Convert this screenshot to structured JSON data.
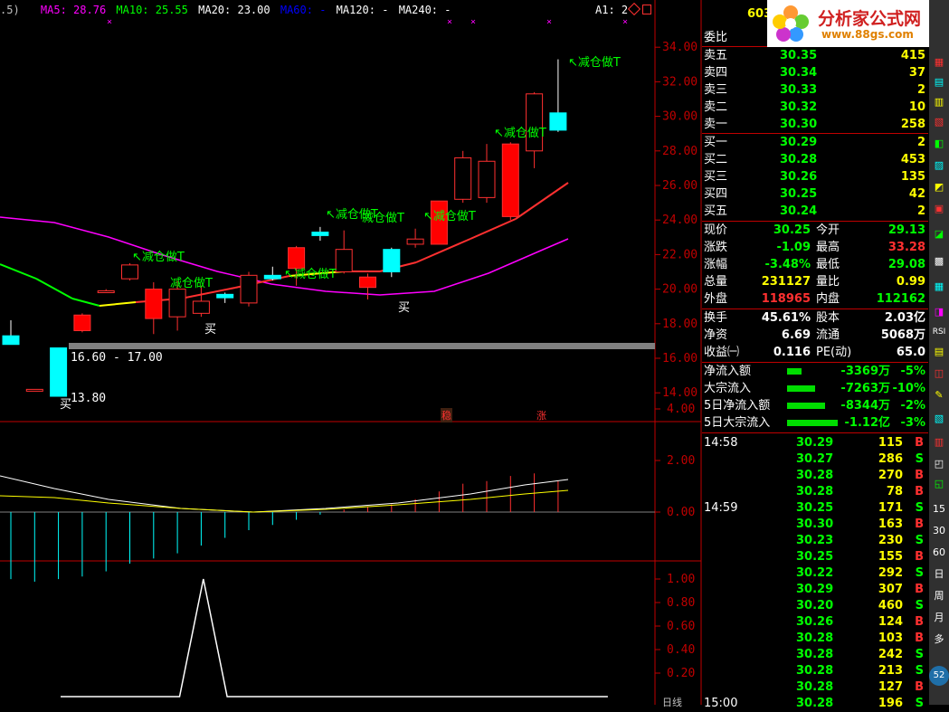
{
  "ma_header": {
    "prefix": ".5)",
    "ma5": "MA5: 28.76",
    "ma10": "MA10: 25.55",
    "ma20": "MA20: 23.00",
    "ma60": "MA60: -",
    "ma120": "MA120: -",
    "ma240": "MA240: -",
    "a1": "A1: 2",
    "code": "603"
  },
  "logo": {
    "text": "分析家公式网",
    "url": "www.88gs.com"
  },
  "price_axis": [
    "34.00",
    "32.00",
    "30.00",
    "28.00",
    "26.00",
    "24.00",
    "22.00",
    "20.00",
    "18.00",
    "16.00",
    "14.00"
  ],
  "macd_axis": [
    "4.00",
    "2.00",
    "0.00"
  ],
  "ind_axis": [
    "1.00",
    "0.80",
    "0.60",
    "0.40",
    "0.20"
  ],
  "annotations": {
    "range_label": "16.60 - 17.00",
    "low_label": "13.80",
    "buy": "买",
    "reduce": "减仓做T",
    "arrow": "↖",
    "wen": "稳",
    "zhang": "涨"
  },
  "order_book": {
    "weibi_label": "委比",
    "sells": [
      {
        "label": "卖五",
        "price": "30.35",
        "vol": "415"
      },
      {
        "label": "卖四",
        "price": "30.34",
        "vol": "37"
      },
      {
        "label": "卖三",
        "price": "30.33",
        "vol": "2"
      },
      {
        "label": "卖二",
        "price": "30.32",
        "vol": "10"
      },
      {
        "label": "卖一",
        "price": "30.30",
        "vol": "258"
      }
    ],
    "buys": [
      {
        "label": "买一",
        "price": "30.29",
        "vol": "2"
      },
      {
        "label": "买二",
        "price": "30.28",
        "vol": "453"
      },
      {
        "label": "买三",
        "price": "30.26",
        "vol": "135"
      },
      {
        "label": "买四",
        "price": "30.25",
        "vol": "42"
      },
      {
        "label": "买五",
        "price": "30.24",
        "vol": "2"
      }
    ]
  },
  "quote": [
    {
      "l1": "现价",
      "v1": "30.25",
      "l2": "今开",
      "v2": "29.13",
      "c1": "#00ff00",
      "c2": "#00ff00"
    },
    {
      "l1": "涨跌",
      "v1": "-1.09",
      "l2": "最高",
      "v2": "33.28",
      "c1": "#00ff00",
      "c2": "#ff3030"
    },
    {
      "l1": "涨幅",
      "v1": "-3.48%",
      "l2": "最低",
      "v2": "29.08",
      "c1": "#00ff00",
      "c2": "#00ff00"
    },
    {
      "l1": "总量",
      "v1": "231127",
      "l2": "量比",
      "v2": "0.99",
      "c1": "#ffff00",
      "c2": "#ffff00"
    },
    {
      "l1": "外盘",
      "v1": "118965",
      "l2": "内盘",
      "v2": "112162",
      "c1": "#ff3030",
      "c2": "#00ff00"
    },
    {
      "l1": "换手",
      "v1": "45.61%",
      "l2": "股本",
      "v2": "2.03亿",
      "c1": "#ffffff",
      "c2": "#ffffff"
    },
    {
      "l1": "净资",
      "v1": "6.69",
      "l2": "流通",
      "v2": "5068万",
      "c1": "#ffffff",
      "c2": "#ffffff"
    },
    {
      "l1": "收益㈠",
      "v1": "0.116",
      "l2": "PE(动)",
      "v2": "65.0",
      "c1": "#ffffff",
      "c2": "#ffffff"
    }
  ],
  "flows": [
    {
      "label": "净流入额",
      "value": "-3369万",
      "pct": "-5%",
      "bar": 0.28
    },
    {
      "label": "大宗流入",
      "value": "-7263万",
      "pct": "-10%",
      "bar": 0.55
    },
    {
      "label": "5日净流入额",
      "value": "-8344万",
      "pct": "-2%",
      "bar": 0.75
    },
    {
      "label": "5日大宗流入",
      "value": "-1.12亿",
      "pct": "-3%",
      "bar": 1.0
    }
  ],
  "ticks": [
    {
      "time": "14:58",
      "price": "30.29",
      "vol": "115",
      "side": "B"
    },
    {
      "time": "",
      "price": "30.27",
      "vol": "286",
      "side": "S"
    },
    {
      "time": "",
      "price": "30.28",
      "vol": "270",
      "side": "B"
    },
    {
      "time": "",
      "price": "30.28",
      "vol": "78",
      "side": "B"
    },
    {
      "time": "14:59",
      "price": "30.25",
      "vol": "171",
      "side": "S"
    },
    {
      "time": "",
      "price": "30.30",
      "vol": "163",
      "side": "B"
    },
    {
      "time": "",
      "price": "30.23",
      "vol": "230",
      "side": "S"
    },
    {
      "time": "",
      "price": "30.25",
      "vol": "155",
      "side": "B"
    },
    {
      "time": "",
      "price": "30.22",
      "vol": "292",
      "side": "S"
    },
    {
      "time": "",
      "price": "30.29",
      "vol": "307",
      "side": "B"
    },
    {
      "time": "",
      "price": "30.20",
      "vol": "460",
      "side": "S"
    },
    {
      "time": "",
      "price": "30.26",
      "vol": "124",
      "side": "B"
    },
    {
      "time": "",
      "price": "30.28",
      "vol": "103",
      "side": "B"
    },
    {
      "time": "",
      "price": "30.28",
      "vol": "242",
      "side": "S"
    },
    {
      "time": "",
      "price": "30.28",
      "vol": "213",
      "side": "S"
    },
    {
      "time": "",
      "price": "30.28",
      "vol": "127",
      "side": "B"
    },
    {
      "time": "15:00",
      "price": "30.28",
      "vol": "196",
      "side": "S"
    }
  ],
  "toolbar": [
    "15",
    "30",
    "60",
    "日",
    "周",
    "月",
    "多"
  ],
  "toolbar_badge": "52",
  "period_label": "日线",
  "chart_data": {
    "type": "candlestick",
    "ylim": [
      13.0,
      35.0
    ],
    "candles": [
      {
        "o": 17.3,
        "c": 16.8,
        "h": 18.2,
        "l": 16.8
      },
      {
        "o": 14.2,
        "c": 14.2,
        "h": 14.2,
        "l": 14.2
      },
      {
        "o": 16.6,
        "c": 13.8,
        "h": 16.6,
        "l": 13.8
      },
      {
        "o": 17.6,
        "c": 18.5,
        "h": 18.6,
        "l": 17.5
      },
      {
        "o": 19.9,
        "c": 19.9,
        "h": 20.0,
        "l": 19.8
      },
      {
        "o": 20.6,
        "c": 21.4,
        "h": 21.5,
        "l": 20.5
      },
      {
        "o": 18.3,
        "c": 20.0,
        "h": 20.4,
        "l": 17.4
      },
      {
        "o": 18.4,
        "c": 20.0,
        "h": 20.5,
        "l": 17.6
      },
      {
        "o": 18.6,
        "c": 19.3,
        "h": 20.2,
        "l": 18.4
      },
      {
        "o": 19.7,
        "c": 19.5,
        "h": 19.8,
        "l": 19.2
      },
      {
        "o": 19.2,
        "c": 20.8,
        "h": 21.0,
        "l": 19.0
      },
      {
        "o": 20.8,
        "c": 20.6,
        "h": 21.3,
        "l": 20.5
      },
      {
        "o": 21.2,
        "c": 22.4,
        "h": 22.5,
        "l": 20.2
      },
      {
        "o": 23.3,
        "c": 23.1,
        "h": 23.6,
        "l": 22.8
      },
      {
        "o": 21.0,
        "c": 22.3,
        "h": 23.4,
        "l": 20.9
      },
      {
        "o": 20.1,
        "c": 20.7,
        "h": 20.9,
        "l": 19.4
      },
      {
        "o": 22.3,
        "c": 21.0,
        "h": 22.4,
        "l": 20.7
      },
      {
        "o": 22.6,
        "c": 22.9,
        "h": 23.5,
        "l": 22.4
      },
      {
        "o": 22.6,
        "c": 25.1,
        "h": 25.1,
        "l": 22.6
      },
      {
        "o": 25.2,
        "c": 27.6,
        "h": 28.0,
        "l": 25.0
      },
      {
        "o": 25.3,
        "c": 27.4,
        "h": 28.4,
        "l": 25.0
      },
      {
        "o": 24.2,
        "c": 28.4,
        "h": 28.5,
        "l": 24.0
      },
      {
        "o": 28.0,
        "c": 31.3,
        "h": 31.4,
        "l": 27.0
      },
      {
        "o": 30.2,
        "c": 29.2,
        "h": 33.3,
        "l": 29.1
      }
    ],
    "macd": [
      -2.6,
      -2.7,
      -2.6,
      -2.5,
      -2.3,
      -2.0,
      -1.8,
      -1.6,
      -1.3,
      -1.0,
      -0.7,
      -0.5,
      -0.3,
      -0.1,
      0.1,
      0.2,
      0.3,
      0.5,
      0.8,
      1.1,
      1.2,
      1.4,
      1.5,
      1.2
    ],
    "indicator": [
      0,
      0,
      0,
      0,
      0,
      0,
      1,
      0,
      0,
      0,
      0,
      0,
      0,
      0,
      0,
      0,
      0,
      0,
      0,
      0,
      0,
      0,
      0,
      0
    ]
  },
  "colors": {
    "up": "#ff3030",
    "down": "#00ffff",
    "ma5": "#ffffff",
    "ma10": "#ffff00",
    "ma20": "#ff00ff",
    "ma60": "#00ff00",
    "ma120": "#0000ff",
    "ma240": "#ffffff"
  }
}
